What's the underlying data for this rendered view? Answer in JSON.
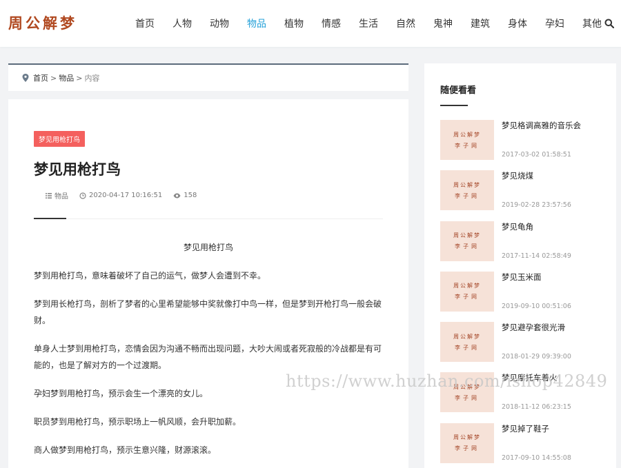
{
  "header": {
    "logo": "周公解梦",
    "nav": [
      {
        "label": "首页"
      },
      {
        "label": "人物"
      },
      {
        "label": "动物"
      },
      {
        "label": "物品",
        "active": true
      },
      {
        "label": "植物"
      },
      {
        "label": "情感"
      },
      {
        "label": "生活"
      },
      {
        "label": "自然"
      },
      {
        "label": "鬼神"
      },
      {
        "label": "建筑"
      },
      {
        "label": "身体"
      },
      {
        "label": "孕妇"
      },
      {
        "label": "其他"
      }
    ],
    "search_icon": "search-icon"
  },
  "breadcrumb": {
    "home": "首页",
    "sep": ">",
    "category": "物品",
    "current": "内容"
  },
  "article": {
    "tag": "梦见用枪打鸟",
    "title": "梦见用枪打鸟",
    "meta": {
      "category": "物品",
      "datetime": "2020-04-17 10:16:51",
      "views": "158"
    },
    "heading": "梦见用枪打鸟",
    "paragraphs": [
      "梦到用枪打鸟，意味着破坏了自己的运气，做梦人会遭到不幸。",
      "梦到用长枪打鸟，剖析了梦者的心里希望能够中奖就像打中鸟一样，但是梦到开枪打鸟一般会破财。",
      "单身人士梦到用枪打鸟，恋情会因为沟通不畅而出现问题，大吵大闹或者死寂般的冷战都是有可能的，也是了解对方的一个过渡期。",
      "孕妇梦到用枪打鸟，预示会生一个漂亮的女儿。",
      "职员梦到用枪打鸟，预示职场上一帆风顺，会升职加薪。",
      "商人做梦到用枪打鸟，预示生意兴隆，财源滚滚。"
    ]
  },
  "sidebar": {
    "title": "随便看看",
    "thumb_line1": "周公解梦",
    "thumb_line2": "李子网",
    "items": [
      {
        "title": "梦见格调高雅的音乐会",
        "date": "2017-03-02 01:58:51"
      },
      {
        "title": "梦见烧煤",
        "date": "2019-02-28 23:57:56"
      },
      {
        "title": "梦见龟角",
        "date": "2017-11-14 02:58:49"
      },
      {
        "title": "梦见玉米面",
        "date": "2019-09-10 00:51:06"
      },
      {
        "title": "梦见避孕套很光滑",
        "date": "2018-01-29 09:39:00"
      },
      {
        "title": "梦见摩托车着火",
        "date": "2018-11-12 06:23:15"
      },
      {
        "title": "梦见掉了鞋子",
        "date": "2017-09-10 14:55:08"
      }
    ]
  },
  "watermark": "https://www.huzhan.com/ishop42849",
  "colors": {
    "accent": "#23a0d8",
    "tag": "#f4605e",
    "logo": "#b0481f"
  }
}
